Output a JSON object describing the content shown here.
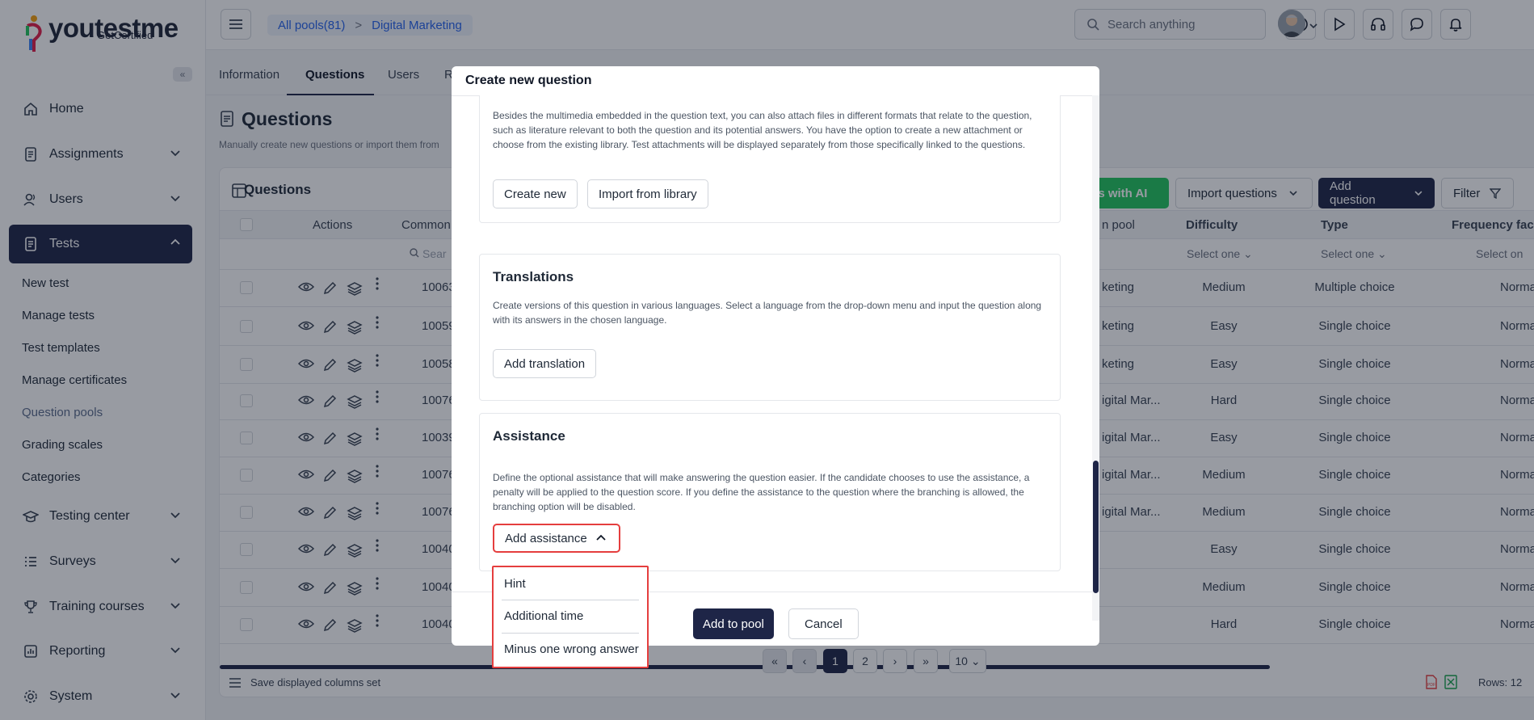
{
  "brand": {
    "name_you": "you",
    "name_test": "test",
    "name_me": "me",
    "sub": "GetCertified",
    "accent": "#1e2547",
    "green": "#22c55e",
    "red": "#e53e3e"
  },
  "sidebar": {
    "items": [
      {
        "label": "Home",
        "icon": "home-icon"
      },
      {
        "label": "Assignments",
        "icon": "document-icon"
      },
      {
        "label": "Users",
        "icon": "users-icon"
      },
      {
        "label": "Tests",
        "icon": "tests-icon"
      },
      {
        "label": "Testing center",
        "icon": "graduation-icon"
      },
      {
        "label": "Surveys",
        "icon": "list-icon"
      },
      {
        "label": "Training courses",
        "icon": "trophy-icon"
      },
      {
        "label": "Reporting",
        "icon": "report-icon"
      },
      {
        "label": "System",
        "icon": "gear-icon"
      }
    ],
    "sub_items": [
      "New test",
      "Manage tests",
      "Test templates",
      "Manage certificates",
      "Question pools",
      "Grading scales",
      "Categories"
    ]
  },
  "breadcrumb": {
    "root": "All pools(81)",
    "sep": ">",
    "current": "Digital Marketing"
  },
  "search": {
    "placeholder": "Search anything"
  },
  "tabs": [
    "Information",
    "Questions",
    "Users",
    "R"
  ],
  "page": {
    "title": "Questions",
    "desc": "Manually create new questions or import them from"
  },
  "card": {
    "title": "Questions",
    "ai_label": "ons with AI",
    "import_label": "Import questions",
    "add_label": "Add question",
    "filter_label": "Filter",
    "columns": {
      "actions": "Actions",
      "common": "Common",
      "pool": "n pool",
      "difficulty": "Difficulty",
      "type": "Type",
      "frequency": "Frequency fac"
    },
    "filter_search": "Sear",
    "select_one": "Select one",
    "select_one_cut": "Select on",
    "rows": [
      {
        "id": "10063",
        "pool": "keting",
        "difficulty": "Medium",
        "type": "Multiple choice",
        "freq": "Normal"
      },
      {
        "id": "10059",
        "pool": "keting",
        "difficulty": "Easy",
        "type": "Single choice",
        "freq": "Normal"
      },
      {
        "id": "10058",
        "pool": "keting",
        "difficulty": "Easy",
        "type": "Single choice",
        "freq": "Normal"
      },
      {
        "id": "10076",
        "pool": "igital Mar...",
        "difficulty": "Hard",
        "type": "Single choice",
        "freq": "Normal"
      },
      {
        "id": "10039",
        "pool": "igital Mar...",
        "difficulty": "Easy",
        "type": "Single choice",
        "freq": "Normal"
      },
      {
        "id": "10076",
        "pool": "igital Mar...",
        "difficulty": "Medium",
        "type": "Single choice",
        "freq": "Normal"
      },
      {
        "id": "10076",
        "pool": "igital Mar...",
        "difficulty": "Medium",
        "type": "Single choice",
        "freq": "Normal"
      },
      {
        "id": "10040",
        "pool": "",
        "difficulty": "Easy",
        "type": "Single choice",
        "freq": "Normal"
      },
      {
        "id": "10040",
        "pool": "",
        "difficulty": "Medium",
        "type": "Single choice",
        "freq": "Normal"
      },
      {
        "id": "10040",
        "pool": "",
        "difficulty": "Hard",
        "type": "Single choice",
        "freq": "Normal"
      }
    ],
    "footer": {
      "save_cols": "Save displayed columns set",
      "pages": [
        "1",
        "2"
      ],
      "rows_per_page": "10",
      "rows_total": "Rows: 12"
    }
  },
  "modal": {
    "title": "Create new question",
    "attachments_desc": "Besides the multimedia embedded in the question text, you can also attach files in different formats that relate to the question, such as literature relevant to both the question and its potential answers. You have the option to create a new attachment or choose from the existing library. Test attachments will be displayed separately from those specifically linked to the questions.",
    "create_new": "Create new",
    "import_library": "Import from library",
    "translations_title": "Translations",
    "translations_desc": "Create versions of this question in various languages. Select a language from the drop-down menu and input the question along with its answers in the chosen language.",
    "add_translation": "Add translation",
    "assistance_title": "Assistance",
    "assistance_desc": "Define the optional assistance that will make answering the question easier. If the candidate chooses to use the assistance, a penalty will be applied to the question score. If you define the assistance to the question where the branching is allowed, the branching option will be disabled.",
    "add_assistance": "Add assistance",
    "assistance_options": [
      "Hint",
      "Additional time",
      "Minus one wrong answer"
    ],
    "add_to_pool": "Add to pool",
    "cancel": "Cancel"
  }
}
